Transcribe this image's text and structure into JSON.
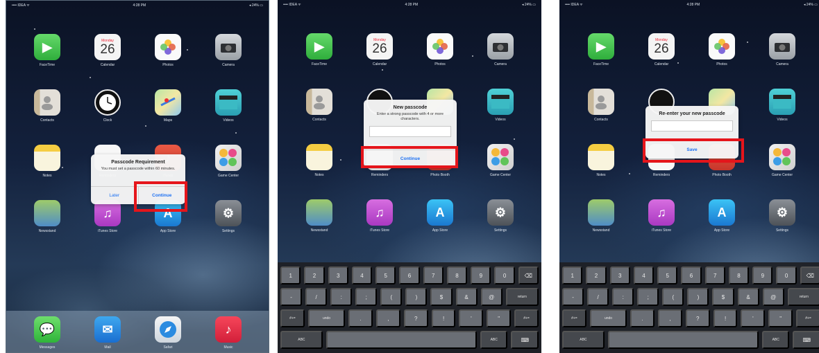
{
  "status_bar": {
    "carrier": "•••• IDEA ᯤ",
    "time": "4:28 PM",
    "battery": "◂ 24% ▭"
  },
  "apps": {
    "facetime": "FaceTime",
    "calendar": "Calendar",
    "calendar_day": "Monday",
    "calendar_date": "26",
    "photos": "Photos",
    "camera": "Camera",
    "contacts": "Contacts",
    "clock": "Clock",
    "maps": "Maps",
    "videos": "Videos",
    "notes": "Notes",
    "reminders": "Reminders",
    "itunes": "iTunes",
    "photo_booth": "Photo Booth",
    "game_center": "Game Center",
    "newsstand": "Newsstand",
    "itunes_store": "iTunes Store",
    "app_store": "App Store",
    "settings": "Settings",
    "messages": "Messages",
    "mail": "Mail",
    "safari": "Safari",
    "music": "Music"
  },
  "screen1": {
    "dialog": {
      "title": "Passcode Requirement",
      "message": "You must set a passcode within 60 minutes.",
      "later": "Later",
      "continue": "Continue"
    }
  },
  "screen2": {
    "dialog": {
      "title": "New passcode",
      "message": "Enter a strong passcode with 4 or more characters.",
      "continue": "Continue"
    }
  },
  "screen3": {
    "dialog": {
      "title": "Re-enter your new passcode",
      "save": "Save"
    }
  },
  "keyboard": {
    "row1": [
      "1",
      "2",
      "3",
      "4",
      "5",
      "6",
      "7",
      "8",
      "9",
      "0",
      "⌫"
    ],
    "row2": [
      "-",
      "/",
      ":",
      ";",
      "(",
      ")",
      "$",
      "&",
      "@",
      "return"
    ],
    "row3": [
      "#+=",
      "undo",
      ".",
      ",",
      "?",
      "!",
      "'",
      "\"",
      "#+="
    ],
    "row4": [
      "ABC",
      "",
      "ABC",
      "⌨"
    ]
  },
  "colors": {
    "highlight": "#e5151b",
    "dialog_button": "#1a6ff2"
  }
}
